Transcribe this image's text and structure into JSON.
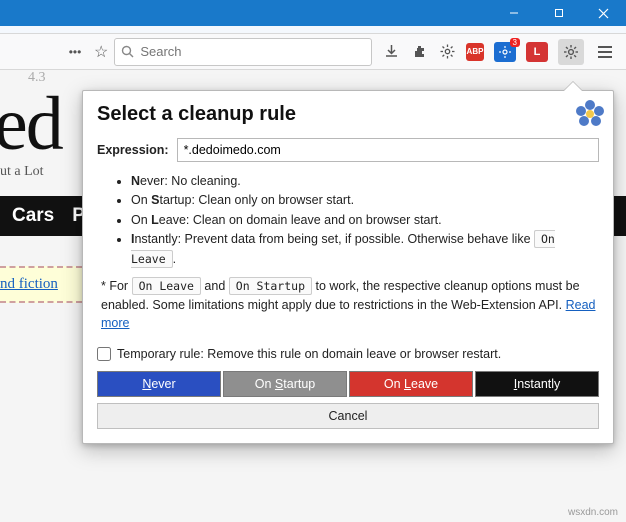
{
  "window": {
    "minimize": "—",
    "maximize": "❐",
    "close": "✕"
  },
  "toolbar": {
    "more": "•••",
    "search_placeholder": "Search",
    "abp": "ABP",
    "ext_badge_num": "3",
    "ext_letter": "L"
  },
  "page": {
    "rating1": "4.3",
    "title_frag": "ed",
    "subtitle": "ut a Lot",
    "nav1": "Cars",
    "nav2": "P",
    "link": "nd fiction"
  },
  "popup": {
    "title": "Select a cleanup rule",
    "expression_label": "Expression:",
    "expression_value": "*.dedoimedo.com",
    "rules": {
      "never_b": "N",
      "never_rest": "ever: No cleaning.",
      "startup_pre": "On ",
      "startup_b": "S",
      "startup_rest": "tartup: Clean only on browser start.",
      "leave_pre": "On ",
      "leave_b": "L",
      "leave_rest": "eave: Clean on domain leave and on browser start.",
      "instant_b": "I",
      "instant_rest": "nstantly: Prevent data from being set, if possible. Otherwise behave like ",
      "instant_code": "On Leave",
      "instant_period": "."
    },
    "note_star": "* For ",
    "note_code1": "On Leave",
    "note_and": " and ",
    "note_code2": "On Startup",
    "note_rest": " to work, the respective cleanup options must be enabled. Some limitations might apply due to restrictions in the Web-Extension API. ",
    "note_link": "Read more",
    "temp_label": "Temporary rule: Remove this rule on domain leave or browser restart.",
    "btn_never_pre": "",
    "btn_never_u": "N",
    "btn_never_post": "ever",
    "btn_startup_pre": "On ",
    "btn_startup_u": "S",
    "btn_startup_post": "tartup",
    "btn_leave_pre": "On ",
    "btn_leave_u": "L",
    "btn_leave_post": "eave",
    "btn_instant_pre": "",
    "btn_instant_u": "I",
    "btn_instant_post": "nstantly",
    "btn_cancel": "Cancel"
  },
  "watermark": "wsxdn.com"
}
